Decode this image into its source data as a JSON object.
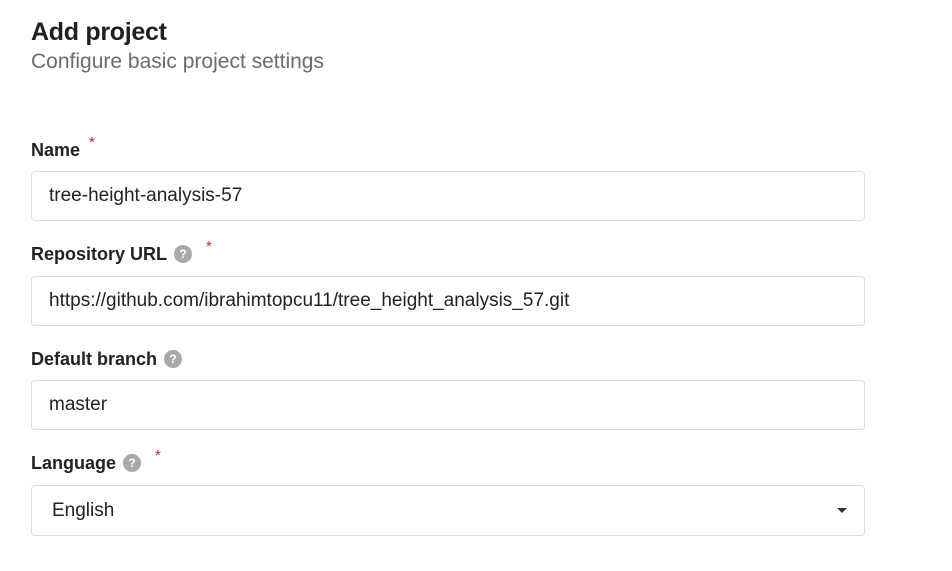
{
  "header": {
    "title": "Add project",
    "subtitle": "Configure basic project settings"
  },
  "form": {
    "name": {
      "label": "Name",
      "required_mark": "*",
      "value": "tree-height-analysis-57"
    },
    "repository_url": {
      "label": "Repository URL",
      "help_glyph": "?",
      "required_mark": "*",
      "value": "https://github.com/ibrahimtopcu11/tree_height_analysis_57.git"
    },
    "default_branch": {
      "label": "Default branch",
      "help_glyph": "?",
      "value": "master"
    },
    "language": {
      "label": "Language",
      "help_glyph": "?",
      "required_mark": "*",
      "selected": "English"
    }
  },
  "icons": {
    "help": "question-circle-icon",
    "dropdown": "caret-down-icon"
  },
  "colors": {
    "required": "#dd2222",
    "help_icon_bg": "#a9a9a9",
    "input_border": "#dcdcdc",
    "subtitle": "#6b6b6b"
  }
}
